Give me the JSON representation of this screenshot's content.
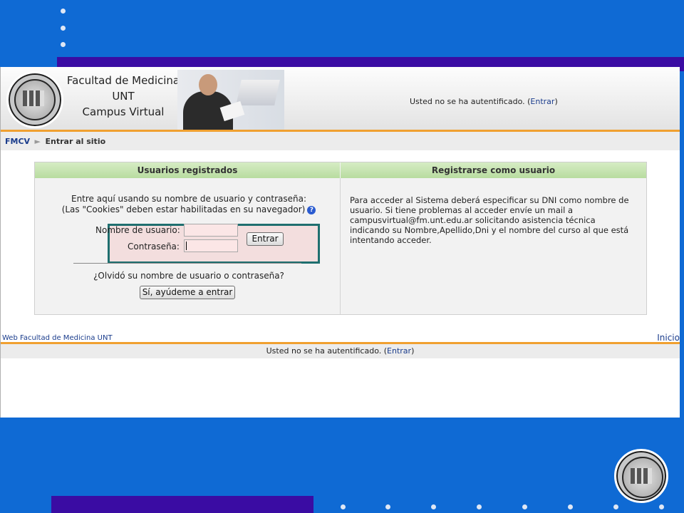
{
  "site": {
    "title_line1": "Facultad de Medicina UNT",
    "title_line2": "Campus Virtual"
  },
  "header": {
    "status_text": "Usted no se ha autentificado. (",
    "status_link": "Entrar",
    "status_close": ")"
  },
  "breadcrumb": {
    "home": "FMCV",
    "separator": "►",
    "current": "Entrar al sitio"
  },
  "login": {
    "left_heading": "Usuarios registrados",
    "right_heading": "Registrarse como usuario",
    "intro_line1": "Entre aquí usando su nombre de usuario y contraseña:",
    "intro_line2": "(Las \"Cookies\" deben estar habilitadas en su navegador)",
    "help_icon": "?",
    "username_label": "Nombre de usuario:",
    "password_label": "Contraseña:",
    "username_value": "",
    "password_value": "",
    "submit_label": "Entrar",
    "forgot_text": "¿Olvidó su nombre de usuario o contraseña?",
    "forgot_button": "Sí, ayúdeme a entrar",
    "register_text": "Para acceder al Sistema deberá especificar su DNI como nombre de usuario. Si tiene problemas al acceder envíe un mail a campusvirtual@fm.unt.edu.ar solicitando asistencia técnica indicando su Nombre,Apellido,Dni y el nombre del curso al que está intentando acceder."
  },
  "footer": {
    "left_link": "Web Facultad de Medicina UNT",
    "right_link": "Inicio",
    "status_text": "Usted no se ha autentificado. (",
    "status_link": "Entrar",
    "status_close": ")"
  },
  "colors": {
    "slide_background": "#0f6ad4",
    "slide_accent": "#3a0ca3",
    "orange_rule": "#f0a030",
    "green_heading": "#b8dca0",
    "highlight_border": "#1f6f6f"
  }
}
